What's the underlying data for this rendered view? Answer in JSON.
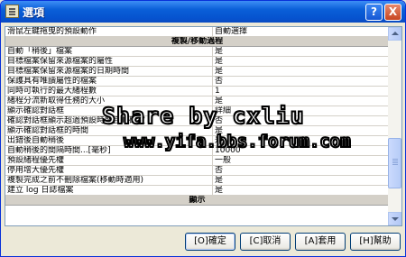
{
  "window": {
    "title": "選項",
    "help_button": "?",
    "close_button": "X"
  },
  "list": {
    "top_row": {
      "key": "滑鼠左鍵拖曳的預設動作",
      "value": "自動選擇"
    },
    "section_header": "複製/移動過程",
    "rows": [
      {
        "key": "自動「稍後」檔案",
        "value": "是"
      },
      {
        "key": "目標檔案保留來源檔案的屬性",
        "value": "是"
      },
      {
        "key": "目標檔案保留來源檔案的日期時間",
        "value": "是"
      },
      {
        "key": "保護具有唯讀屬性的檔案",
        "value": "否"
      },
      {
        "key": "同時可執行的最大緒程數",
        "value": "1"
      },
      {
        "key": "緒程分流新取得任務的大小",
        "value": "是"
      },
      {
        "key": "顯示確認對話框",
        "value": "詳細"
      },
      {
        "key": "確認對話框顯示超過預設時間自動確定",
        "value": "否"
      },
      {
        "key": "顯示確認對話框的時間",
        "value": "是"
      },
      {
        "key": "出錯後自動稍後",
        "value": "是"
      },
      {
        "key": "自動稍後的間隔時間...[毫秒]",
        "value": "10000"
      },
      {
        "key": "預設緒程優先權",
        "value": "一般"
      },
      {
        "key": "停用增大優先權",
        "value": "否"
      },
      {
        "key": "複製完成之前不刪除檔案(移動時適用)",
        "value": "是"
      },
      {
        "key": "建立 log 日誌檔案",
        "value": "是"
      }
    ],
    "bottom_header": "顯示"
  },
  "buttons": {
    "ok": "[O]確定",
    "cancel": "[C]取消",
    "apply": "[A]套用",
    "help": "[H]幫助"
  },
  "watermark": {
    "line1": "Share by cxliu",
    "line2": "www.yifa.bbs.forum.com"
  },
  "colors": {
    "titlebar": "#0a5fd8",
    "face": "#ece9d8",
    "grid": "#d4d0c8"
  }
}
